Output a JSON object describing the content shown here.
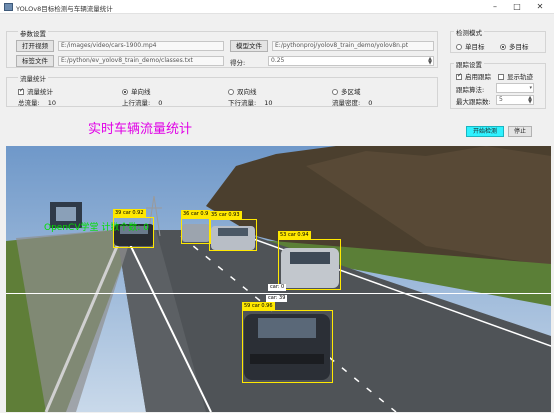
{
  "window": {
    "title": "YOLOv8目标检测与车辆流量统计",
    "minimize": "–",
    "maximize": "□",
    "close": "✕"
  },
  "params": {
    "group_title": "参数设置",
    "open_video_label": "打开视频",
    "video_path": "E:/images/video/cars-1900.mp4",
    "model_file_label": "模型文件",
    "model_path": "E:/pythonproj/yolov8_train_demo/yolov8n.pt",
    "label_file_label": "标签文件",
    "label_path": "E:/python/ev_yolov8_train_demo/classes.txt",
    "score_label": "得分:",
    "score_value": "0.25"
  },
  "flow": {
    "group_title": "流量统计",
    "enable_label": "流量统计",
    "enable_checked": true,
    "directions": [
      {
        "label": "单向线",
        "checked": true
      },
      {
        "label": "双向线",
        "checked": false
      },
      {
        "label": "多区域",
        "checked": false
      }
    ],
    "stats": [
      {
        "label": "总流量:",
        "value": "10"
      },
      {
        "label": "上行流量:",
        "value": "0"
      },
      {
        "label": "下行流量:",
        "value": "10"
      },
      {
        "label": "流量密度:",
        "value": "0"
      }
    ]
  },
  "detect_mode": {
    "group_title": "检测模式",
    "options": [
      {
        "label": "单目标",
        "checked": false
      },
      {
        "label": "多目标",
        "checked": true
      }
    ]
  },
  "track": {
    "group_title": "跟踪设置",
    "enable_label": "启用跟踪",
    "enable_checked": true,
    "show_label": "显示轨迹",
    "show_checked": false,
    "algo_label": "跟踪算法:",
    "algo_value": "",
    "max_label": "最大跟踪数:",
    "max_value": "5"
  },
  "main": {
    "heading": "实时车辆流量统计",
    "start_label": "开始检测",
    "stop_label": "停止"
  },
  "video": {
    "overlay_text": "OpenCV学堂 计数个数: 0",
    "detections": [
      {
        "tag": "39 car 0.92"
      },
      {
        "tag": "36 car 0.9"
      },
      {
        "tag": "35 car 0.93"
      },
      {
        "tag": "53 car 0.94"
      },
      {
        "tag": "59 car 0.96"
      }
    ],
    "cross_tags": [
      "car: 0",
      "car: 39"
    ]
  }
}
